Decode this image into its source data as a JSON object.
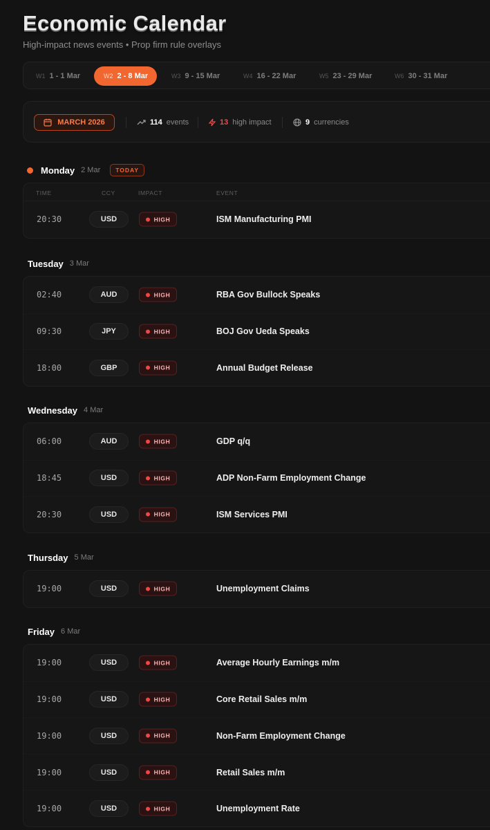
{
  "header": {
    "title": "Economic Calendar",
    "subtitle": "High-impact news events • Prop firm rule overlays"
  },
  "weeks": [
    {
      "num": "W1",
      "label": "1 - 1 Mar",
      "active": false
    },
    {
      "num": "W2",
      "label": "2 - 8 Mar",
      "active": true
    },
    {
      "num": "W3",
      "label": "9 - 15 Mar",
      "active": false
    },
    {
      "num": "W4",
      "label": "16 - 22 Mar",
      "active": false
    },
    {
      "num": "W5",
      "label": "23 - 29 Mar",
      "active": false
    },
    {
      "num": "W6",
      "label": "30 - 31 Mar",
      "active": false
    }
  ],
  "summary": {
    "month": "MARCH 2026",
    "events_count": "114",
    "events_label": "events",
    "high_count": "13",
    "high_label": "high impact",
    "currencies_count": "9",
    "currencies_label": "currencies"
  },
  "columns": {
    "time": "TIME",
    "ccy": "CCY",
    "impact": "IMPACT",
    "event": "EVENT"
  },
  "colors": {
    "accent": "#f2662f",
    "high": "#f04646",
    "background": "#131313"
  },
  "days": [
    {
      "name": "Monday",
      "date": "2 Mar",
      "today_badge": "TODAY",
      "events": [
        {
          "time": "20:30",
          "ccy": "USD",
          "impact": "HIGH",
          "title": "ISM Manufacturing PMI"
        }
      ]
    },
    {
      "name": "Tuesday",
      "date": "3 Mar",
      "events": [
        {
          "time": "02:40",
          "ccy": "AUD",
          "impact": "HIGH",
          "title": "RBA Gov Bullock Speaks"
        },
        {
          "time": "09:30",
          "ccy": "JPY",
          "impact": "HIGH",
          "title": "BOJ Gov Ueda Speaks"
        },
        {
          "time": "18:00",
          "ccy": "GBP",
          "impact": "HIGH",
          "title": "Annual Budget Release"
        }
      ]
    },
    {
      "name": "Wednesday",
      "date": "4 Mar",
      "events": [
        {
          "time": "06:00",
          "ccy": "AUD",
          "impact": "HIGH",
          "title": "GDP q/q"
        },
        {
          "time": "18:45",
          "ccy": "USD",
          "impact": "HIGH",
          "title": "ADP Non-Farm Employment Change"
        },
        {
          "time": "20:30",
          "ccy": "USD",
          "impact": "HIGH",
          "title": "ISM Services PMI"
        }
      ]
    },
    {
      "name": "Thursday",
      "date": "5 Mar",
      "events": [
        {
          "time": "19:00",
          "ccy": "USD",
          "impact": "HIGH",
          "title": "Unemployment Claims"
        }
      ]
    },
    {
      "name": "Friday",
      "date": "6 Mar",
      "events": [
        {
          "time": "19:00",
          "ccy": "USD",
          "impact": "HIGH",
          "title": "Average Hourly Earnings m/m"
        },
        {
          "time": "19:00",
          "ccy": "USD",
          "impact": "HIGH",
          "title": "Core Retail Sales m/m"
        },
        {
          "time": "19:00",
          "ccy": "USD",
          "impact": "HIGH",
          "title": "Non-Farm Employment Change"
        },
        {
          "time": "19:00",
          "ccy": "USD",
          "impact": "HIGH",
          "title": "Retail Sales m/m"
        },
        {
          "time": "19:00",
          "ccy": "USD",
          "impact": "HIGH",
          "title": "Unemployment Rate"
        }
      ]
    }
  ]
}
